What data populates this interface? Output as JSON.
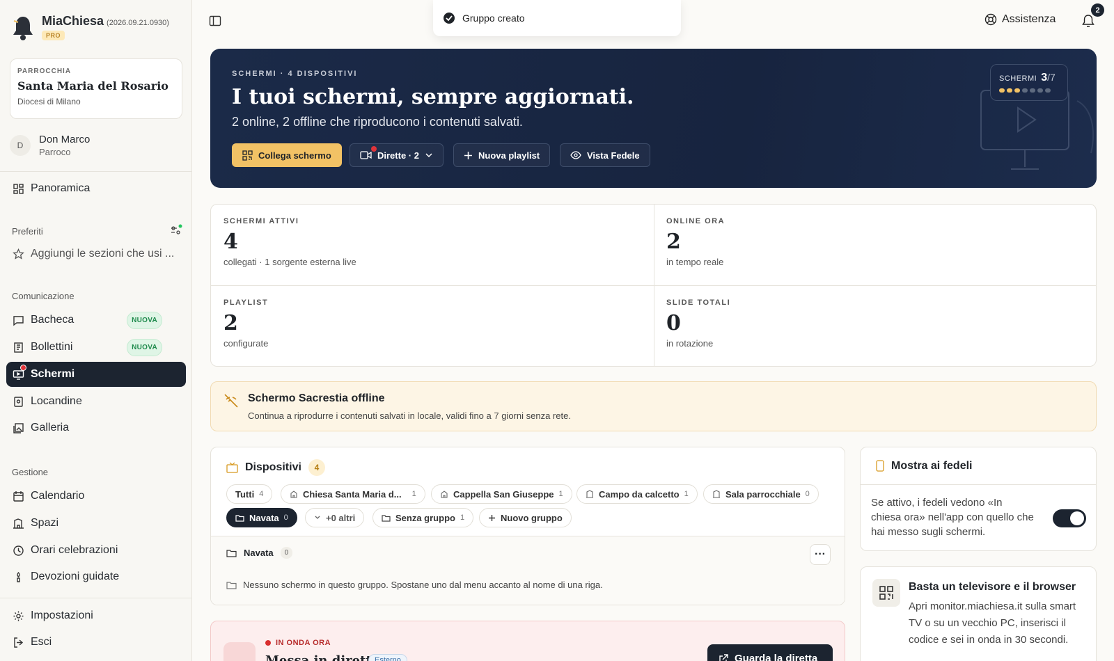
{
  "brand": {
    "name": "MiaChiesa",
    "version": "(2026.09.21.0930)",
    "tier": "PRO"
  },
  "parish": {
    "label": "PARROCCHIA",
    "name": "Santa Maria del Rosario",
    "diocese": "Diocesi di Milano"
  },
  "user": {
    "initial": "D",
    "name": "Don Marco",
    "role": "Parroco"
  },
  "nav": {
    "overview": "Panoramica",
    "favorites_header": "Preferiti",
    "favorites_hint": "Aggiungi le sezioni che usi ...",
    "communication_header": "Comunicazione",
    "bacheca": "Bacheca",
    "bollettini": "Bollettini",
    "new_badge": "NUOVA",
    "schermi": "Schermi",
    "locandine": "Locandine",
    "galleria": "Galleria",
    "management_header": "Gestione",
    "calendario": "Calendario",
    "spazi": "Spazi",
    "orari": "Orari celebrazioni",
    "devozioni": "Devozioni guidate",
    "impostazioni": "Impostazioni",
    "esci": "Esci"
  },
  "topbar": {
    "toast": "Gruppo creato",
    "help": "Assistenza",
    "notifications": "2"
  },
  "hero": {
    "kicker": "SCHERMI · 4 DISPOSITIVI",
    "title": "I tuoi schermi, sempre aggiornati.",
    "subtitle": "2 online, 2 offline che riproducono i contenuti salvati.",
    "btn_connect": "Collega schermo",
    "btn_live": "Dirette · 2",
    "btn_playlist": "Nuova playlist",
    "btn_view": "Vista Fedele",
    "counter_label": "SCHERMI",
    "counter_value": "3",
    "counter_total": "/7",
    "counter_used": 3,
    "counter_max": 7
  },
  "stats": [
    {
      "label": "SCHERMI ATTIVI",
      "value": "4",
      "desc": "collegati · 1 sorgente esterna live"
    },
    {
      "label": "ONLINE ORA",
      "value": "2",
      "desc": "in tempo reale"
    },
    {
      "label": "PLAYLIST",
      "value": "2",
      "desc": "configurate"
    },
    {
      "label": "SLIDE TOTALI",
      "value": "0",
      "desc": "in rotazione"
    }
  ],
  "alert": {
    "title": "Schermo Sacrestia offline",
    "desc": "Continua a riprodurre i contenuti salvati in locale, validi fino a 7 giorni senza rete."
  },
  "devices": {
    "title": "Dispositivi",
    "count": "4",
    "chips": [
      {
        "label": "Tutti",
        "count": "4"
      },
      {
        "label": "Chiesa Santa Maria d...",
        "count": "1"
      },
      {
        "label": "Cappella San Giuseppe",
        "count": "1"
      },
      {
        "label": "Campo da calcetto",
        "count": "1"
      },
      {
        "label": "Sala parrocchiale",
        "count": "0"
      },
      {
        "label": "Navata",
        "count": "0"
      },
      {
        "label": "+0 altri",
        "count": ""
      },
      {
        "label": "Senza gruppo",
        "count": "1"
      },
      {
        "label": "Nuovo gruppo",
        "count": ""
      }
    ],
    "group": {
      "name": "Navata",
      "count": "0",
      "more": "···",
      "empty": "Nessuno schermo in questo gruppo. Spostane uno dal menu accanto al nome di una riga."
    }
  },
  "live": {
    "kicker": "IN ONDA ORA",
    "title": "Messa in diretta",
    "tag": "Esterno",
    "button": "Guarda la diretta"
  },
  "show_faithful": {
    "title": "Mostra ai fedeli",
    "desc": "Se attivo, i fedeli vedono «In chiesa ora» nell'app con quello che hai messo sugli schermi.",
    "enabled": true
  },
  "tv_tip": {
    "title": "Basta un televisore e il browser",
    "desc": "Apri monitor.miachiesa.it sulla smart TV o su un vecchio PC, inserisci il codice e sei in onda in 30 secondi."
  },
  "colors": {
    "accent": "#f2c265",
    "dark": "#1c2430",
    "hero": "#1b2a48",
    "new_badge": "#1f8a4c",
    "live_red": "#d92f2f"
  }
}
